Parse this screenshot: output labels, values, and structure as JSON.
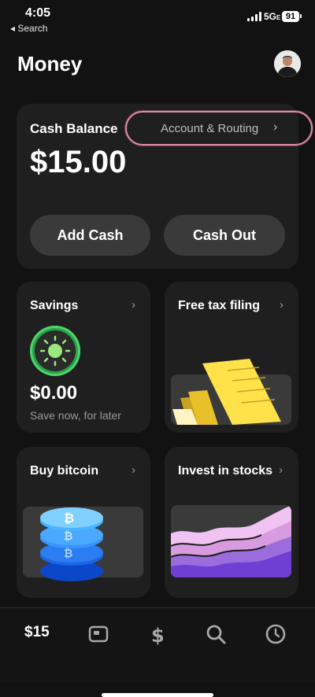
{
  "status_bar": {
    "time": "4:05",
    "back_label": "◂ Search",
    "network": "5G",
    "network_suffix": "E",
    "battery": "91"
  },
  "header": {
    "title": "Money",
    "avatar": "profile-photo"
  },
  "balance": {
    "label": "Cash Balance",
    "routing_label": "Account & Routing",
    "amount": "$15.00",
    "add_cash": "Add Cash",
    "cash_out": "Cash Out"
  },
  "tiles": {
    "savings": {
      "title": "Savings",
      "amount": "$0.00",
      "subtitle": "Save now, for later"
    },
    "tax": {
      "title": "Free tax filing"
    },
    "bitcoin": {
      "title": "Buy bitcoin"
    },
    "stocks": {
      "title": "Invest in stocks"
    }
  },
  "bottom_nav": {
    "balance": "$15",
    "items": [
      "card-icon",
      "dollar-icon",
      "search-icon",
      "clock-icon"
    ]
  },
  "colors": {
    "accent_green": "#25a244",
    "highlight_pink": "#e28aa8",
    "card": "#1f1f1f"
  }
}
